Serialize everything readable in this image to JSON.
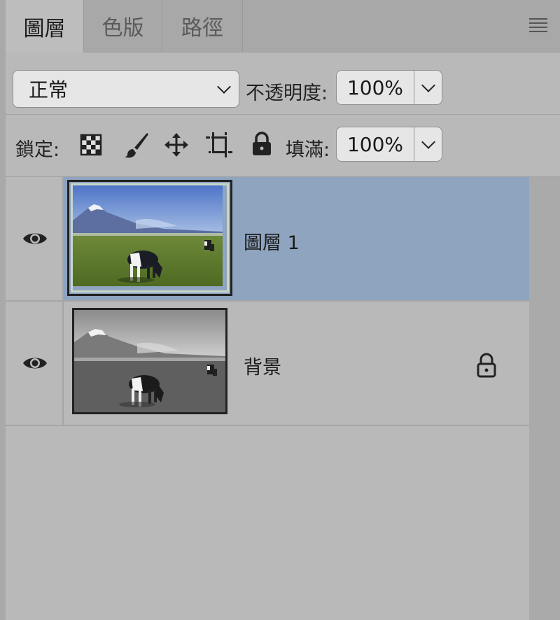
{
  "tabs": [
    {
      "label": "圖層",
      "active": true
    },
    {
      "label": "色版",
      "active": false
    },
    {
      "label": "路徑",
      "active": false
    }
  ],
  "blend_mode": {
    "value": "正常"
  },
  "opacity": {
    "label": "不透明度:",
    "value": "100%"
  },
  "lock": {
    "label": "鎖定:",
    "icons": [
      "checkerboard-icon",
      "brush-icon",
      "move-icon",
      "artboard-icon",
      "lock-icon"
    ]
  },
  "fill": {
    "label": "填滿:",
    "value": "100%"
  },
  "layers": [
    {
      "name": "圖層 1",
      "visible": true,
      "selected": true,
      "locked": false,
      "thumbnail": "color"
    },
    {
      "name": "背景",
      "visible": true,
      "selected": false,
      "locked": true,
      "thumbnail": "grayscale"
    }
  ],
  "colors": {
    "selected_row": "#8ea4bf",
    "panel": "#b9b9b9"
  }
}
